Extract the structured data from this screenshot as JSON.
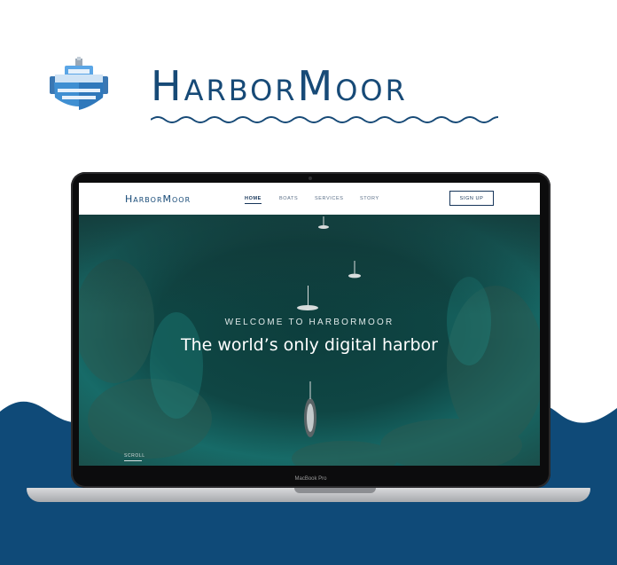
{
  "brand": {
    "name": "HarborMoor",
    "logo_icon": "ship-icon"
  },
  "colors": {
    "navy": "#0f4a78",
    "brand_text": "#174a77",
    "ship_blue": "#3f8fd2"
  },
  "laptop": {
    "model_label": "MacBook Pro"
  },
  "website": {
    "nav": {
      "logo": "HarborMoor",
      "links": [
        {
          "label": "HOME",
          "active": true
        },
        {
          "label": "BOATS",
          "active": false
        },
        {
          "label": "SERVICES",
          "active": false
        },
        {
          "label": "STORY",
          "active": false
        }
      ],
      "signup_label": "SIGN UP"
    },
    "hero": {
      "kicker": "WELCOME TO HARBORMOOR",
      "title": "The world’s only digital harbor",
      "scroll_label": "SCROLL"
    }
  }
}
